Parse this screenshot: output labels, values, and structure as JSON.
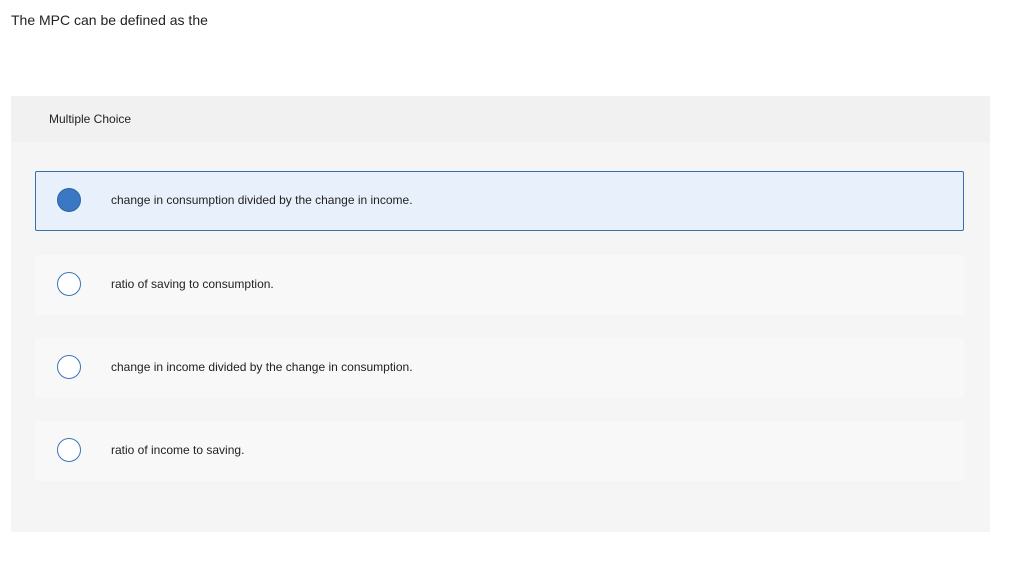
{
  "question": {
    "text": "The MPC can be defined as the"
  },
  "multiple_choice": {
    "header_label": "Multiple Choice",
    "selected_index": 0,
    "options": [
      {
        "text": "change in consumption divided by the change in income.",
        "selected": true
      },
      {
        "text": "ratio of saving to consumption.",
        "selected": false
      },
      {
        "text": "change in income divided by the change in consumption.",
        "selected": false
      },
      {
        "text": "ratio of income to saving.",
        "selected": false
      }
    ]
  },
  "colors": {
    "selected_background": "#e8f1fb",
    "selected_border": "#3b6fa8",
    "radio_fill": "#3a78c3",
    "radio_border": "#3b74b8"
  }
}
